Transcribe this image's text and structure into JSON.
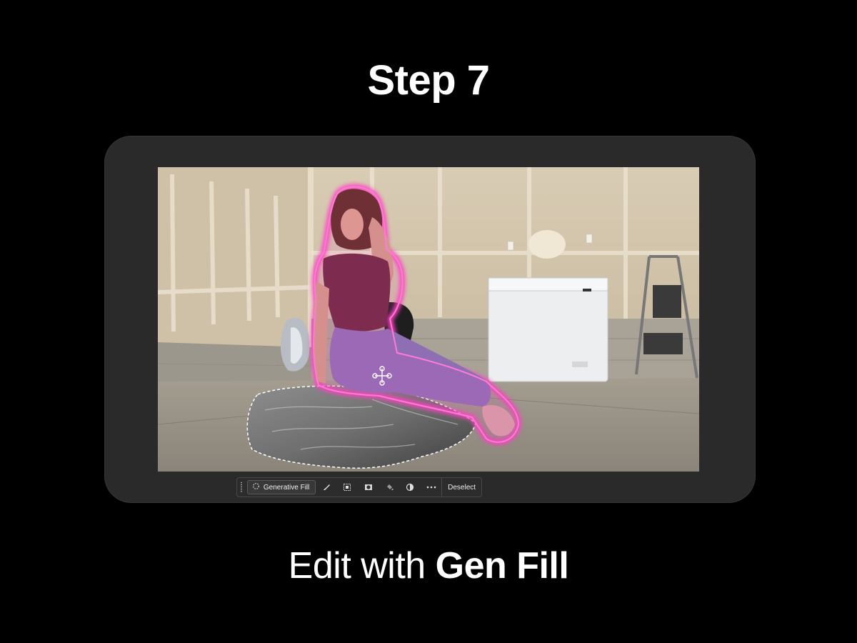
{
  "slide": {
    "title": "Step 7",
    "caption_regular": "Edit with ",
    "caption_bold": "Gen Fill"
  },
  "taskbar": {
    "generative_fill_label": "Generative Fill",
    "deselect_label": "Deselect",
    "icons": [
      "sparkle-icon",
      "brush-icon",
      "invert-selection-icon",
      "mask-icon",
      "fill-icon",
      "adjustment-icon",
      "more-icon"
    ]
  },
  "colors": {
    "background": "#000000",
    "device_frame": "#2a2a2a",
    "selection_outline": "#ff3fc2",
    "taskbar_bg": "#2c2c2c"
  }
}
